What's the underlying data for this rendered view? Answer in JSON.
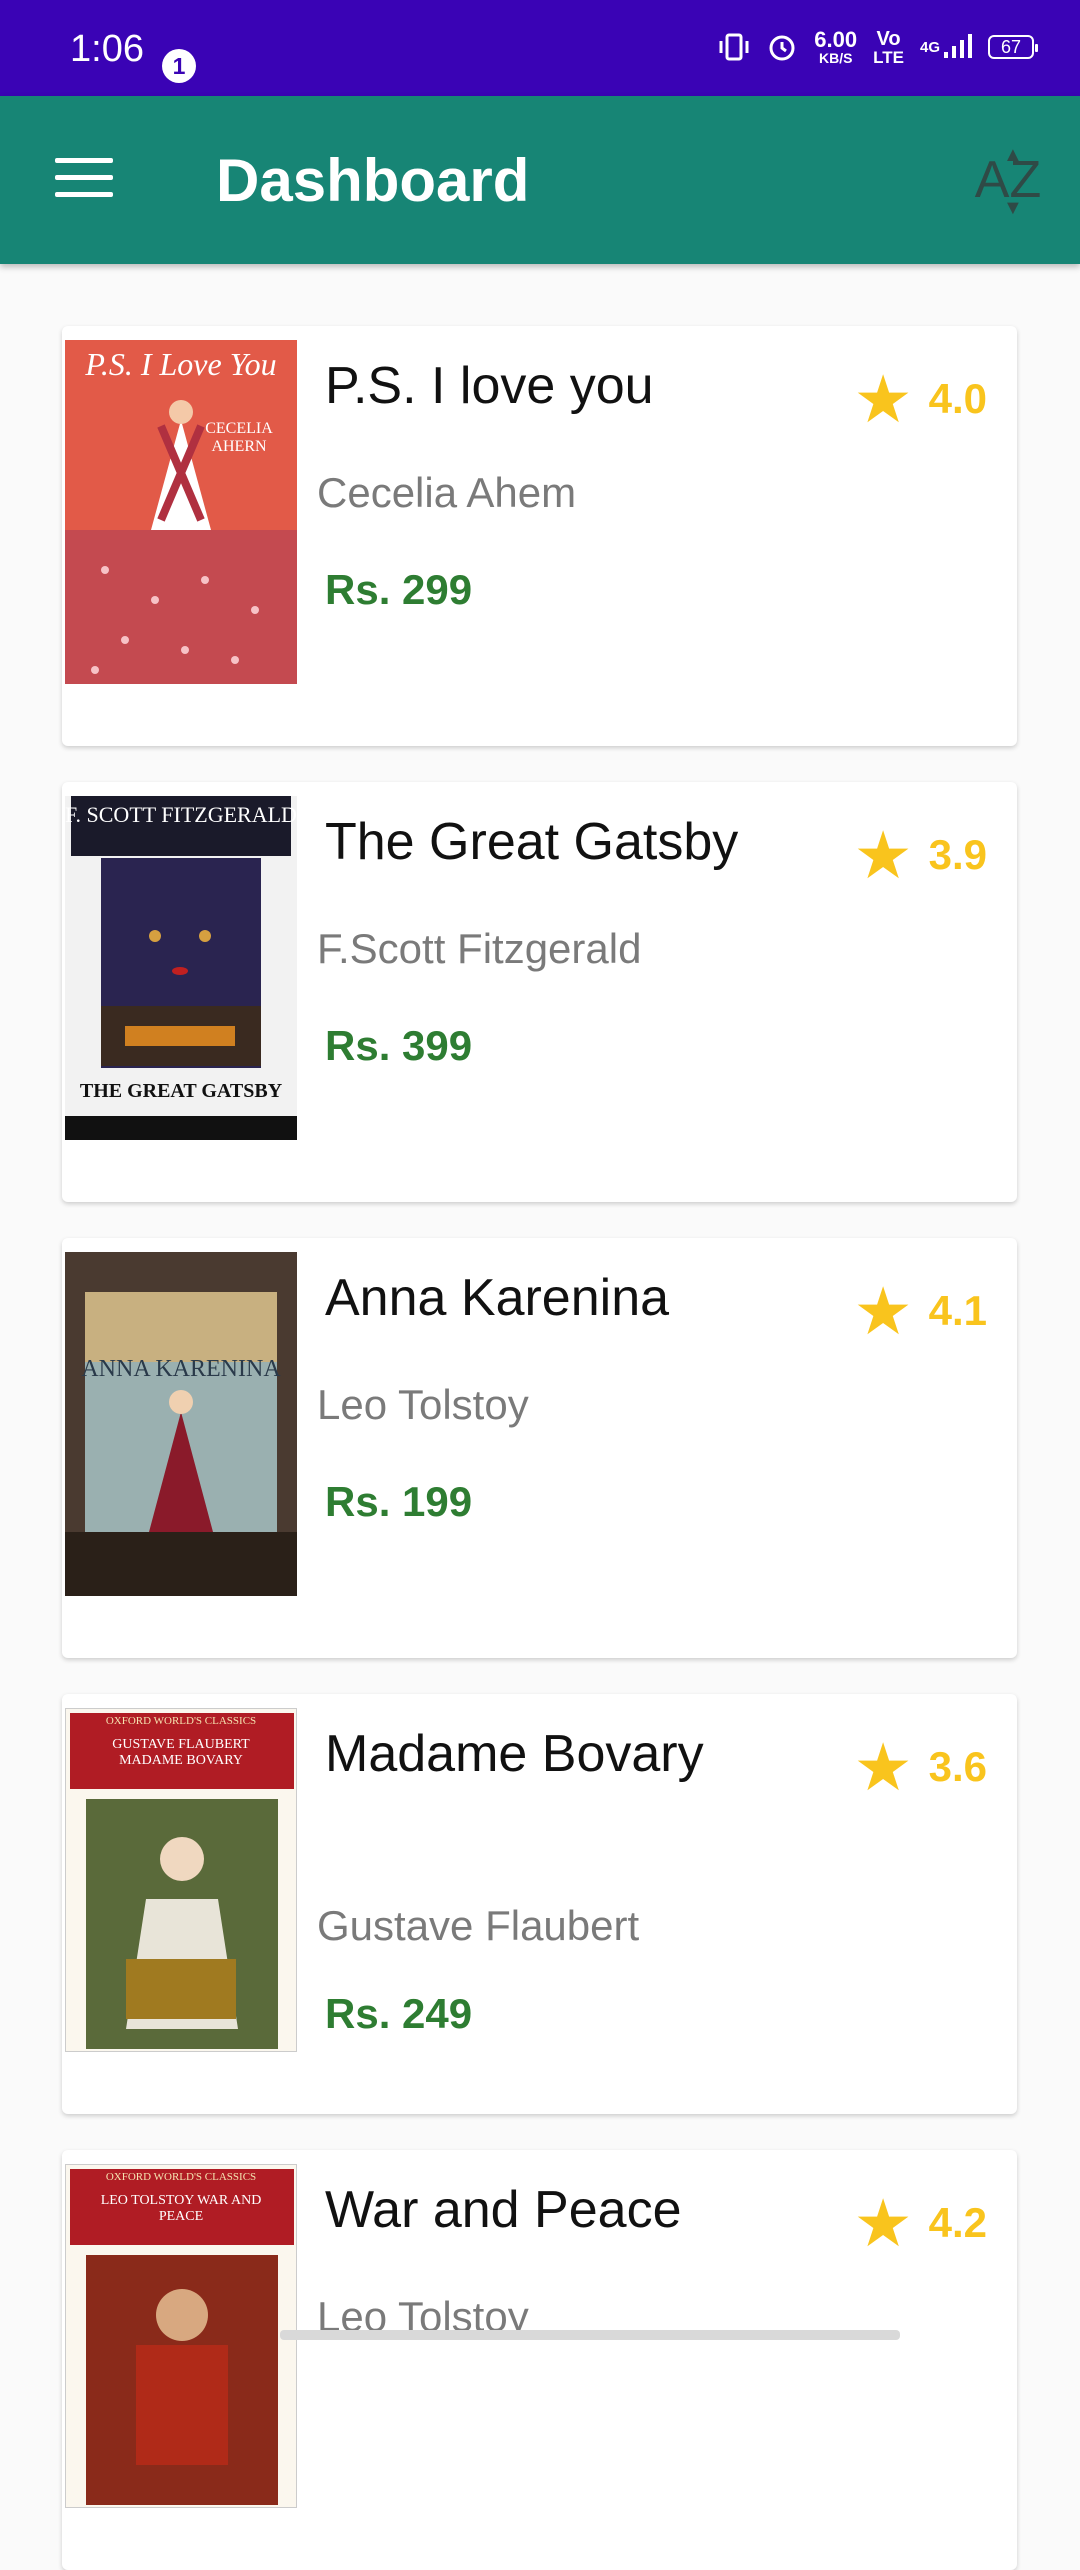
{
  "status": {
    "time": "1:06",
    "notification_count": "1",
    "net_speed_value": "6.00",
    "net_speed_unit": "KB/S",
    "volte_top": "Vo",
    "volte_bottom": "LTE",
    "network": "4G",
    "battery": "67"
  },
  "app_bar": {
    "title": "Dashboard",
    "sort_label": "AZ"
  },
  "books": [
    {
      "title": "P.S. I love you",
      "author": "Cecelia Ahem",
      "price": "Rs. 299",
      "rating": "4.0",
      "cover": {
        "bg": "#e85a47",
        "text": "P.S. I Love You",
        "sub": "CECELIA AHERN"
      }
    },
    {
      "title": "The Great Gatsby",
      "author": "F.Scott Fitzgerald",
      "price": "Rs. 399",
      "rating": "3.9",
      "cover": {
        "bg": "#1c1a3a",
        "text": "F. SCOTT FITZGERALD",
        "sub": "THE GREAT GATSBY"
      }
    },
    {
      "title": "Anna Karenina",
      "author": "Leo Tolstoy",
      "price": "Rs. 199",
      "rating": "4.1",
      "cover": {
        "bg": "#5a6a6a",
        "text": "ANNA KARENINA",
        "sub": ""
      }
    },
    {
      "title": "Madame Bovary",
      "author": "Gustave Flaubert",
      "price": "Rs. 249",
      "rating": "3.6",
      "cover": {
        "bg": "#3a5a2a",
        "text": "OXFORD WORLD'S CLASSICS",
        "sub": "GUSTAVE FLAUBERT MADAME BOVARY"
      }
    },
    {
      "title": "War and Peace",
      "author": "Leo Tolstoy",
      "price": "",
      "rating": "4.2",
      "cover": {
        "bg": "#7a2a1a",
        "text": "OXFORD WORLD'S CLASSICS",
        "sub": "LEO TOLSTOY WAR AND PEACE"
      }
    }
  ],
  "colors": {
    "status_bar": "#3a03b5",
    "app_bar": "#178575",
    "price": "#2e7d32",
    "rating": "#f9c41d"
  }
}
